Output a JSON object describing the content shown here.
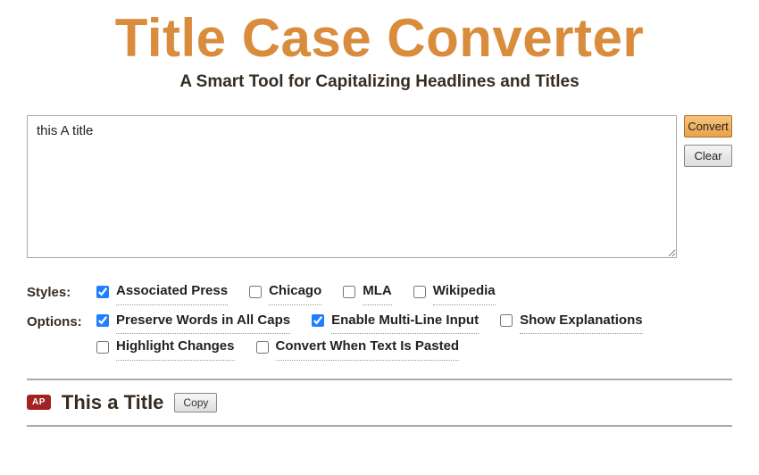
{
  "header": {
    "title": "Title Case Converter",
    "subtitle": "A Smart Tool for Capitalizing Headlines and Titles"
  },
  "input": {
    "text": "this A title"
  },
  "buttons": {
    "convert": "Convert",
    "clear": "Clear",
    "copy": "Copy"
  },
  "styles_label": "Styles:",
  "options_label": "Options:",
  "styles": [
    {
      "label": "Associated Press",
      "checked": true
    },
    {
      "label": "Chicago",
      "checked": false
    },
    {
      "label": "MLA",
      "checked": false
    },
    {
      "label": "Wikipedia",
      "checked": false
    }
  ],
  "options": [
    {
      "label": "Preserve Words in All Caps",
      "checked": true
    },
    {
      "label": "Enable Multi-Line Input",
      "checked": true
    },
    {
      "label": "Show Explanations",
      "checked": false
    },
    {
      "label": "Highlight Changes",
      "checked": false
    },
    {
      "label": "Convert When Text Is Pasted",
      "checked": false
    }
  ],
  "result": {
    "badge": "AP",
    "text": "This a Title"
  }
}
